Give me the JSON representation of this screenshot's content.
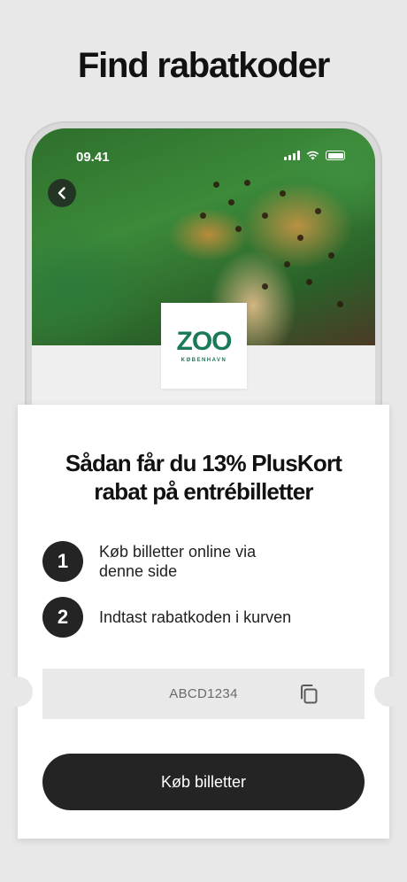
{
  "headline": "Find rabatkoder",
  "status_bar": {
    "time": "09.41"
  },
  "icons": {
    "back": "chevron-left-icon",
    "copy": "copy-icon",
    "signal": "signal-icon",
    "wifi": "wifi-icon",
    "battery": "battery-icon"
  },
  "partner": {
    "logo_word": "ZOO",
    "logo_sub": "KØBENHAVN",
    "brand_color": "#1a7a55"
  },
  "card": {
    "title_line1": "Sådan får du 13% PlusKort",
    "title_line2": "rabat på entrébilletter",
    "steps": [
      {
        "number": "1",
        "text_line1": "Køb billetter online via",
        "text_line2": "denne side"
      },
      {
        "number": "2",
        "text_line1": "Indtast rabatkoden i kurven",
        "text_line2": ""
      }
    ],
    "code": "ABCD1234",
    "button_label": "Køb billetter"
  }
}
